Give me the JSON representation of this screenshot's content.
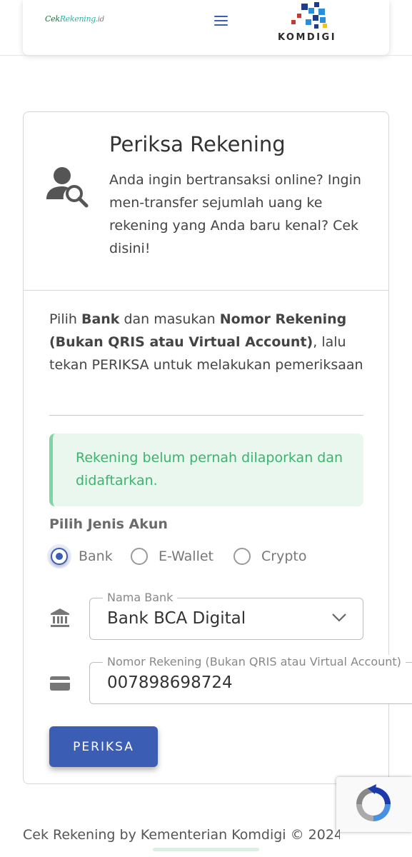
{
  "header": {
    "logo": {
      "part1": "Cek",
      "part2": "Rekening",
      "part3": ".id"
    },
    "menu_icon": "hamburger-menu-icon",
    "brand": "KOMDIGI"
  },
  "card": {
    "title": "Periksa Rekening",
    "description": "Anda ingin bertransaksi online? Ingin men-transfer sejumlah uang ke rekening yang Anda baru kenal? Cek disini!",
    "icon": "user-search-icon"
  },
  "instructions": {
    "t1": "Pilih ",
    "b1": "Bank",
    "t2": " dan masukan ",
    "b2": "Nomor Rekening (Bukan QRIS atau Virtual Account)",
    "t3": ", lalu tekan PERIKSA untuk melakukan pemeriksaan"
  },
  "alert": {
    "message": "Rekening belum pernah dilaporkan dan didaftarkan.",
    "color": "#3cb46e"
  },
  "account_type": {
    "label": "Pilih Jenis Akun",
    "options": [
      {
        "label": "Bank",
        "checked": true
      },
      {
        "label": "E-Wallet",
        "checked": false
      },
      {
        "label": "Crypto",
        "checked": false
      }
    ]
  },
  "bank_field": {
    "label": "Nama Bank",
    "value": "Bank BCA Digital",
    "icon": "bank-icon"
  },
  "account_field": {
    "label": "Nomor Rekening (Bukan QRIS atau Virtual Account)",
    "value": "007898698724",
    "icon": "credit-card-icon"
  },
  "submit": {
    "label": "PERIKSA"
  },
  "footer": {
    "text": "Cek Rekening by Kementerian Komdigi © 2024"
  },
  "colors": {
    "primary": "#3b5db4",
    "alert_bg": "#e9f7ef",
    "alert_border": "#7ed6a5"
  }
}
